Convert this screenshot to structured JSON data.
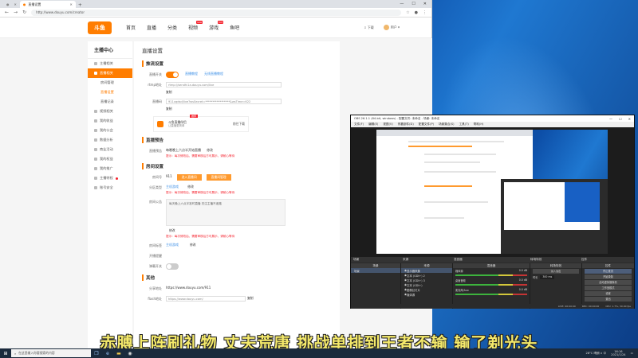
{
  "browser": {
    "tab_label": "直播设置",
    "tab_other": "",
    "url": "http://www.douyu.com/creator",
    "window_controls": [
      "—",
      "☐",
      "✕"
    ]
  },
  "site": {
    "logo": "斗鱼",
    "nav": [
      {
        "label": "首页"
      },
      {
        "label": "直播"
      },
      {
        "label": "分类"
      },
      {
        "label": "视频",
        "badge": "new"
      },
      {
        "label": "游戏",
        "badge": "hot"
      },
      {
        "label": "鱼吧"
      }
    ],
    "download": "下载",
    "user": "用户"
  },
  "sidebar": {
    "title": "主播中心",
    "items": [
      {
        "label": "主播相关",
        "type": "group"
      },
      {
        "label": "直播相关",
        "type": "active"
      },
      {
        "label": "房间管理",
        "type": "sub"
      },
      {
        "label": "直播设置",
        "type": "sub-on"
      },
      {
        "label": "直播记录",
        "type": "sub"
      },
      {
        "label": "视频相关",
        "type": "group"
      },
      {
        "label": "我的收益",
        "type": "group"
      },
      {
        "label": "我的公会",
        "type": "group"
      },
      {
        "label": "数据分析",
        "type": "group"
      },
      {
        "label": "商业活动",
        "type": "group"
      },
      {
        "label": "我的权益",
        "type": "group"
      },
      {
        "label": "我的推广",
        "type": "group"
      },
      {
        "label": "主播特权",
        "type": "group-dot"
      },
      {
        "label": "账号安全",
        "type": "group"
      }
    ]
  },
  "content": {
    "page_title": "直播设置",
    "sec_push": "推流设置",
    "push_switch_label": "直播开关",
    "push_link_a": "直播教程",
    "push_link_b": "无线直播教程",
    "rtmp_label": "rtmp地址",
    "rtmp_value": "rtmp://sendfc1a.douyu.com/live",
    "copy": "复制",
    "key_label": "直播码",
    "key_value": "911xqdsd/live?wsSecret=*****************&wsTime=622",
    "banner_title": "斗鱼直播伴侣",
    "banner_sub": "让直播更简单",
    "banner_btn": "前往下载",
    "banner_tag": "推荐",
    "sec_notice": "直播预告",
    "notice_label": "直播预告",
    "notice_text": "每晚晚上六点半开始直播",
    "notice_edit": "修改",
    "notice_warn": "提示：每次修改后，需要审核后方可展示，请耐心等待",
    "sec_room": "房间设置",
    "room_no_label": "房间号",
    "room_no": "911",
    "room_btn_a": "进入直播间",
    "room_btn_b": "直播间管理",
    "room_cat_label": "分区类型",
    "room_cat": "主机游戏",
    "room_cat_edit": "修改",
    "room_cat_warn": "提示：每次修改后，需要审核后方可展示，请耐心等待",
    "room_notice_label": "房间公告",
    "room_notice": "每天晚上六点半准时直播 关注主播不迷路",
    "room_notice_edit": "修改",
    "room_notice_warn": "提示：每次修改后，需要审核后方可展示，请耐心等待",
    "room_label_label": "房间标签",
    "room_label_value": "主机游戏",
    "room_label_edit": "修改",
    "room_push_label": "开播提醒",
    "room_mute_label": "弹幕开关",
    "sec_other": "其他",
    "share_label": "分享地址",
    "share_value": "https://www.douyu.com/911",
    "flash_label": "flash地址",
    "flash_value": "https://www.douyu.com/",
    "flash_copy": "复制"
  },
  "obs": {
    "title": "OBS 26.1.1 (64-bit, windows) - 配置文件: 未命名 - 场景: 未命名",
    "menu": [
      "文件(F)",
      "编辑(E)",
      "视图(V)",
      "停靠部件(D)",
      "配置文件(P)",
      "场景集合(S)",
      "工具(T)",
      "帮助(H)"
    ],
    "tabs": [
      "场景",
      "来源",
      "混音器",
      "转场特效",
      "控件"
    ],
    "docks": {
      "scenes": "场景",
      "sources": "来源",
      "mixer": "混音器",
      "transitions": "转场特效",
      "controls": "控件"
    },
    "scene_item": "场景",
    "sources": [
      "显示器采集",
      "文本 (GDI+) 2",
      "文本 (GDI+) 3",
      "文本 (GDI+)",
      "图像幻灯片",
      "媒体源"
    ],
    "mixer": [
      {
        "name": "媒体源",
        "db": "0.0 dB"
      },
      {
        "name": "桌面音频",
        "db": "0.0 dB"
      },
      {
        "name": "麦克风/Aux",
        "db": "0.0 dB"
      }
    ],
    "transition": "淡入淡出",
    "duration_label": "时长",
    "duration": "300 ms",
    "controls": [
      "停止推流",
      "开始录制",
      "启动虚拟摄像机",
      "工作室模式",
      "设置",
      "退出"
    ],
    "status": [
      "LIVE: 00:00:00",
      "REC: 00:00:00",
      "CPU: 1.7%, 30.00 fps"
    ]
  },
  "subtitle": "赤膊上阵刷礼物 丈夫荒唐 挑战单排到王者不输 输了剃光头",
  "taskbar": {
    "search": "在这里输入你要搜索的内容",
    "time": "16:16",
    "date": "2021/1/24",
    "tray": "28°C 晴朗 ∧ 中"
  }
}
